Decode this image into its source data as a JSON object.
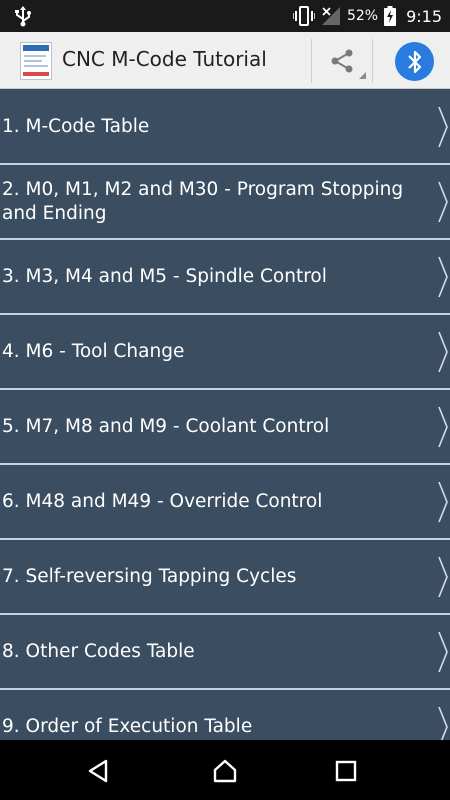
{
  "status_bar": {
    "battery_percent": "52%",
    "time": "9:15",
    "icons": [
      "usb-icon",
      "vibrate-icon",
      "signal-icon",
      "battery-charging-icon"
    ]
  },
  "app_bar": {
    "title": "CNC M-Code Tutorial",
    "icons": [
      "app-logo-icon",
      "share-icon",
      "bluetooth-icon"
    ]
  },
  "topics": [
    {
      "label": "1. M-Code Table"
    },
    {
      "label": "2. M0, M1, M2 and M30 - Program Stopping and Ending"
    },
    {
      "label": "3. M3, M4 and M5 - Spindle Control"
    },
    {
      "label": "4. M6 - Tool Change"
    },
    {
      "label": "5. M7, M8 and M9 - Coolant Control"
    },
    {
      "label": "6. M48 and M49 - Override Control"
    },
    {
      "label": "7. Self-reversing Tapping Cycles"
    },
    {
      "label": "8. Other Codes Table"
    },
    {
      "label": "9. Order of Execution Table"
    }
  ],
  "nav_bar": {
    "icons": [
      "back-icon",
      "home-icon",
      "recents-icon"
    ]
  },
  "colors": {
    "list_background": "#3b4d61",
    "divider": "#c9d3df",
    "app_bar": "#efefef",
    "bluetooth_accent": "#2a7be0"
  }
}
